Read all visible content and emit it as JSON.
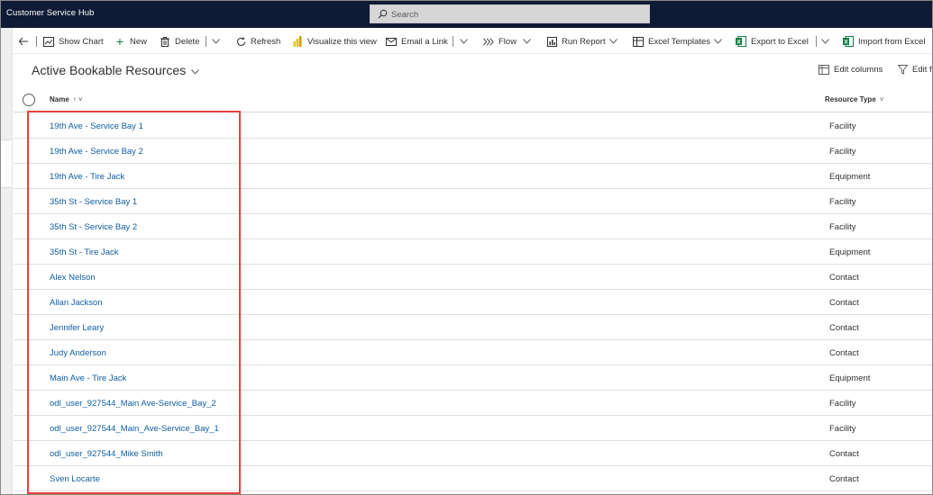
{
  "app": {
    "title": "Customer Service Hub"
  },
  "search": {
    "placeholder": "Search"
  },
  "toolbar": {
    "show_chart": "Show Chart",
    "new": "New",
    "delete": "Delete",
    "refresh": "Refresh",
    "visualize": "Visualize this view",
    "email_link": "Email a Link",
    "flow": "Flow",
    "run_report": "Run Report",
    "excel_templates": "Excel Templates",
    "export_excel": "Export to Excel",
    "import_excel": "Import from Excel"
  },
  "view": {
    "title": "Active Bookable Resources",
    "edit_columns": "Edit columns",
    "edit_filters": "Edit f"
  },
  "grid": {
    "columns": {
      "name": "Name",
      "resource_type": "Resource Type"
    },
    "rows": [
      {
        "name": "19th Ave - Service Bay 1",
        "type": "Facility"
      },
      {
        "name": "19th Ave - Service Bay 2",
        "type": "Facility"
      },
      {
        "name": "19th Ave - Tire Jack",
        "type": "Equipment"
      },
      {
        "name": "35th St - Service Bay 1",
        "type": "Facility"
      },
      {
        "name": "35th St - Service Bay 2",
        "type": "Facility"
      },
      {
        "name": "35th St - Tire Jack",
        "type": "Equipment"
      },
      {
        "name": "Alex Nelson",
        "type": "Contact"
      },
      {
        "name": "Allan Jackson",
        "type": "Contact"
      },
      {
        "name": "Jennifer Leary",
        "type": "Contact"
      },
      {
        "name": "Judy Anderson",
        "type": "Contact"
      },
      {
        "name": "Main Ave - Tire Jack",
        "type": "Equipment"
      },
      {
        "name": "odl_user_927544_Main Ave-Service_Bay_2",
        "type": "Facility"
      },
      {
        "name": "odl_user_927544_Main_Ave-Service_Bay_1",
        "type": "Facility"
      },
      {
        "name": "odl_user_927544_Mike Smith",
        "type": "Contact"
      },
      {
        "name": "Sven Locarte",
        "type": "Contact"
      }
    ]
  },
  "colors": {
    "topbar": "#0f1b35",
    "link": "#115ea3",
    "highlight": "#e8413b",
    "excel_green": "#107c41"
  }
}
